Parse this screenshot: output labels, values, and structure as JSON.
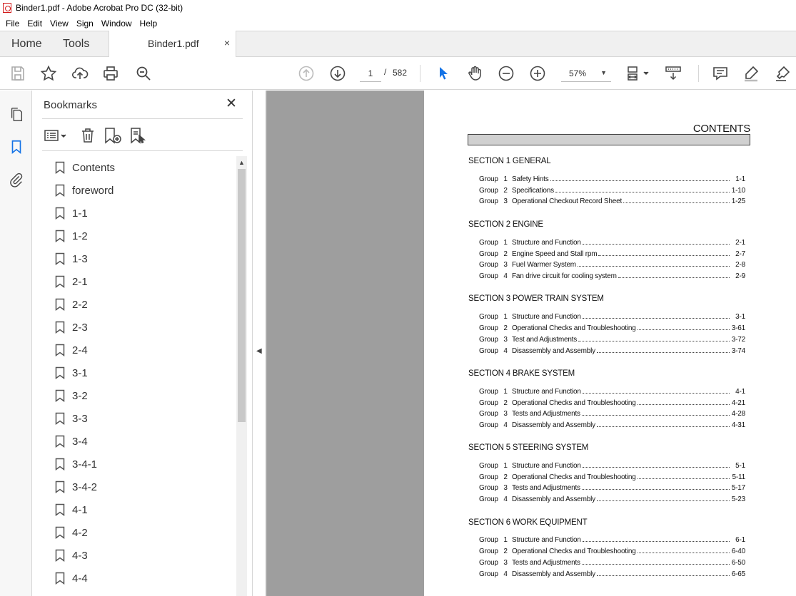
{
  "window": {
    "title": "Binder1.pdf - Adobe Acrobat Pro DC (32-bit)"
  },
  "menu": [
    "File",
    "Edit",
    "View",
    "Sign",
    "Window",
    "Help"
  ],
  "tabs": {
    "home": "Home",
    "tools": "Tools",
    "document": "Binder1.pdf",
    "close": "×"
  },
  "toolbar": {
    "page_current": "1",
    "page_separator": "/",
    "page_total": "582",
    "zoom": "57%"
  },
  "bookmarks": {
    "title": "Bookmarks",
    "close": "✕",
    "items": [
      "Contents",
      "foreword",
      "1-1",
      "1-2",
      "1-3",
      "2-1",
      "2-2",
      "2-3",
      "2-4",
      "3-1",
      "3-2",
      "3-3",
      "3-4",
      "3-4-1",
      "3-4-2",
      "4-1",
      "4-2",
      "4-3",
      "4-4"
    ]
  },
  "document": {
    "heading": "CONTENTS",
    "group_word": "Group",
    "sections": [
      {
        "title": "SECTION 1  GENERAL",
        "rows": [
          {
            "num": "1",
            "title": "Safety Hints",
            "page": "1-1"
          },
          {
            "num": "2",
            "title": "Specifications",
            "page": "1-10"
          },
          {
            "num": "3",
            "title": "Operational Checkout Record Sheet",
            "page": "1-25"
          }
        ]
      },
      {
        "title": "SECTION 2  ENGINE",
        "rows": [
          {
            "num": "1",
            "title": "Structure and Function",
            "page": "2-1"
          },
          {
            "num": "2",
            "title": "Engine Speed and Stall rpm",
            "page": "2-7"
          },
          {
            "num": "3",
            "title": "Fuel Warmer System",
            "page": "2-8"
          },
          {
            "num": "4",
            "title": "Fan drive circuit for cooling system",
            "page": "2-9"
          }
        ]
      },
      {
        "title": "SECTION 3  POWER TRAIN SYSTEM",
        "rows": [
          {
            "num": "1",
            "title": "Structure and Function",
            "page": "3-1"
          },
          {
            "num": "2",
            "title": "Operational Checks and Troubleshooting",
            "page": "3-61"
          },
          {
            "num": "3",
            "title": "Test and Adjustments",
            "page": "3-72"
          },
          {
            "num": "4",
            "title": "Disassembly and Assembly",
            "page": "3-74"
          }
        ]
      },
      {
        "title": "SECTION 4  BRAKE SYSTEM",
        "rows": [
          {
            "num": "1",
            "title": "Structure and Function",
            "page": "4-1"
          },
          {
            "num": "2",
            "title": "Operational Checks and Troubleshooting",
            "page": "4-21"
          },
          {
            "num": "3",
            "title": "Tests and Adjustments",
            "page": "4-28"
          },
          {
            "num": "4",
            "title": "Disassembly and Assembly",
            "page": "4-31"
          }
        ]
      },
      {
        "title": "SECTION 5  STEERING SYSTEM",
        "rows": [
          {
            "num": "1",
            "title": "Structure and Function",
            "page": "5-1"
          },
          {
            "num": "2",
            "title": "Operational Checks and Troubleshooting",
            "page": "5-11"
          },
          {
            "num": "3",
            "title": "Tests and Adjustments",
            "page": "5-17"
          },
          {
            "num": "4",
            "title": "Disassembly and Assembly",
            "page": "5-23"
          }
        ]
      },
      {
        "title": "SECTION 6  WORK EQUIPMENT",
        "rows": [
          {
            "num": "1",
            "title": "Structure and Function",
            "page": "6-1"
          },
          {
            "num": "2",
            "title": "Operational Checks and Troubleshooting",
            "page": "6-40"
          },
          {
            "num": "3",
            "title": "Tests and Adjustments",
            "page": "6-50"
          },
          {
            "num": "4",
            "title": "Disassembly and Assembly",
            "page": "6-65"
          }
        ]
      }
    ]
  },
  "colors": {
    "accent": "#1473e6",
    "pdf_red": "#d21c1c",
    "doc_gray": "#9e9e9e"
  },
  "icons": {
    "toolbar": [
      "save-icon",
      "star-icon",
      "upload-icon",
      "print-icon",
      "search-icon",
      "prev-page-icon",
      "next-page-icon",
      "select-cursor-icon",
      "hand-icon",
      "zoom-out-icon",
      "zoom-in-icon",
      "page-fit-icon",
      "scroll-mode-icon",
      "comment-icon",
      "highlight-icon",
      "sign-icon"
    ],
    "rail": [
      "pages-icon",
      "bookmark-icon",
      "attachment-icon"
    ],
    "bookmark_tools": [
      "options-menu-icon",
      "delete-icon",
      "new-bookmark-icon",
      "new-bookmark-from-structure-icon"
    ]
  }
}
